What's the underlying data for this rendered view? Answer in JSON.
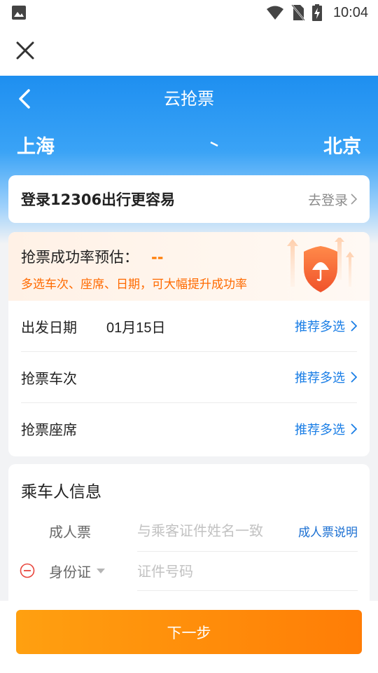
{
  "status_bar": {
    "time": "10:04"
  },
  "header": {
    "title": "云抢票"
  },
  "route": {
    "from": "上海",
    "to": "北京"
  },
  "login": {
    "title": "登录12306出行更容易",
    "link": "去登录"
  },
  "rate": {
    "title": "抢票成功率预估：",
    "value": "--",
    "subtitle": "多选车次、座席、日期，可大幅提升成功率"
  },
  "options": [
    {
      "label": "出发日期",
      "value": "01月15日",
      "link": "推荐多选"
    },
    {
      "label": "抢票车次",
      "value": "",
      "link": "推荐多选"
    },
    {
      "label": "抢票座席",
      "value": "",
      "link": "推荐多选"
    }
  ],
  "passenger": {
    "title": "乘车人信息",
    "ticket_type": "成人票",
    "name_placeholder": "与乘客证件姓名一致",
    "ticket_info_link": "成人票说明",
    "id_type": "身份证",
    "id_placeholder": "证件号码"
  },
  "footer": {
    "next_button": "下一步"
  },
  "colors": {
    "accent_orange": "#ff7d06",
    "link_blue": "#1a7ee6",
    "hero_blue": "#1e8ff0"
  }
}
